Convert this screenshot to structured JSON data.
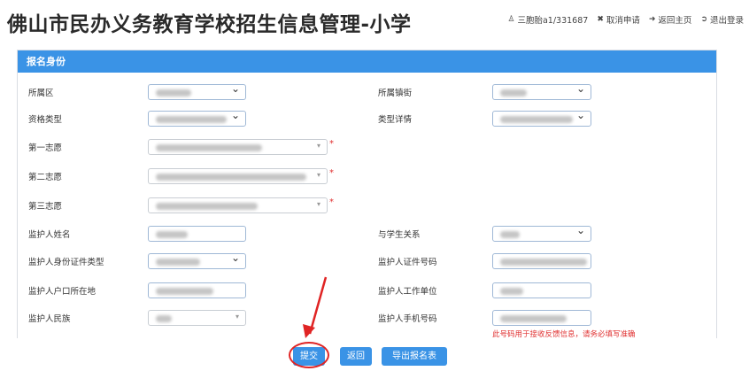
{
  "header": {
    "title": "佛山市民办义务教育学校招生信息管理-小学",
    "user": "三胞胎a1/331687",
    "cancel": "取消申请",
    "home": "返回主页",
    "logout": "退出登录"
  },
  "panel": {
    "title": "报名身份"
  },
  "form": {
    "district_label": "所属区",
    "town_label": "所属镇街",
    "qual_type_label": "资格类型",
    "type_detail_label": "类型详情",
    "choice1_label": "第一志愿",
    "choice2_label": "第二志愿",
    "choice3_label": "第三志愿",
    "guardian_name_label": "监护人姓名",
    "relation_label": "与学生关系",
    "id_type_label": "监护人身份证件类型",
    "id_number_label": "监护人证件号码",
    "hukou_label": "监护人户口所在地",
    "workplace_label": "监护人工作单位",
    "ethnicity_label": "监护人民族",
    "phone_label": "监护人手机号码",
    "required_mark": "*",
    "phone_note": "此号码用于接收反馈信息，请务必填写准确"
  },
  "buttons": {
    "submit": "提交",
    "back": "返回",
    "export": "导出报名表"
  },
  "colors": {
    "accent": "#3a93e6",
    "highlight": "#e02424"
  }
}
